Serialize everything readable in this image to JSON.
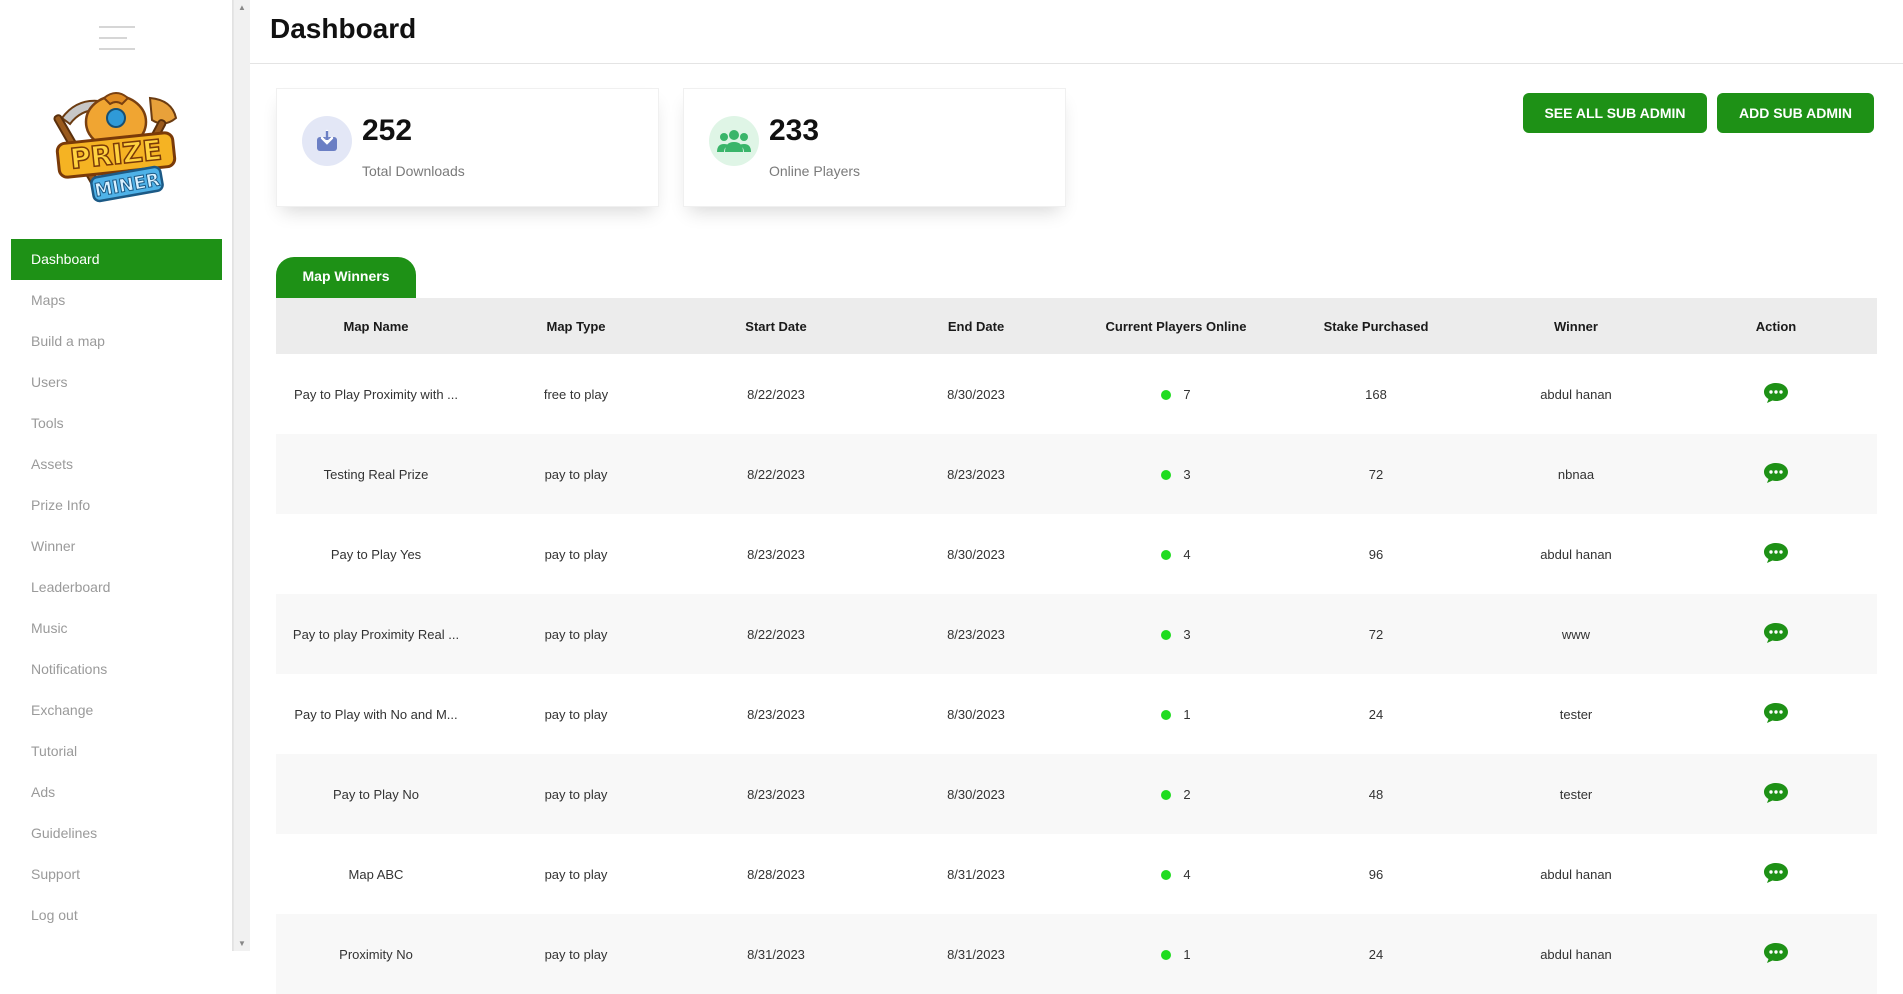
{
  "sidebar": {
    "logo_text": [
      "PRIZE",
      "MINER"
    ],
    "items": [
      {
        "label": "Dashboard",
        "active": true
      },
      {
        "label": "Maps"
      },
      {
        "label": "Build a map"
      },
      {
        "label": "Users"
      },
      {
        "label": "Tools"
      },
      {
        "label": "Assets"
      },
      {
        "label": "Prize Info"
      },
      {
        "label": "Winner"
      },
      {
        "label": "Leaderboard"
      },
      {
        "label": "Music"
      },
      {
        "label": "Notifications"
      },
      {
        "label": "Exchange"
      },
      {
        "label": "Tutorial"
      },
      {
        "label": "Ads"
      },
      {
        "label": "Guidelines"
      },
      {
        "label": "Support"
      },
      {
        "label": "Log out"
      }
    ]
  },
  "header": {
    "title": "Dashboard"
  },
  "stats": [
    {
      "value": "252",
      "label": "Total Downloads",
      "icon": "download-icon",
      "icon_bg": "#e3e7f6",
      "icon_color": "#6b7fc4"
    },
    {
      "value": "233",
      "label": "Online Players",
      "icon": "users-icon",
      "icon_bg": "#dff5e6",
      "icon_color": "#3ab56a"
    }
  ],
  "buttons": {
    "see_all": "SEE ALL SUB ADMIN",
    "add": "ADD SUB ADMIN"
  },
  "tab": {
    "label": "Map Winners"
  },
  "table": {
    "columns": [
      "Map Name",
      "Map Type",
      "Start Date",
      "End Date",
      "Current Players Online",
      "Stake Purchased",
      "Winner",
      "Action"
    ],
    "rows": [
      {
        "map_name": "Pay to Play Proximity with ...",
        "map_type": "free to play",
        "start": "8/22/2023",
        "end": "8/30/2023",
        "players": "7",
        "stake": "168",
        "winner": "abdul hanan"
      },
      {
        "map_name": "Testing Real Prize",
        "map_type": "pay to play",
        "start": "8/22/2023",
        "end": "8/23/2023",
        "players": "3",
        "stake": "72",
        "winner": "nbnaa"
      },
      {
        "map_name": "Pay to Play Yes",
        "map_type": "pay to play",
        "start": "8/23/2023",
        "end": "8/30/2023",
        "players": "4",
        "stake": "96",
        "winner": "abdul hanan"
      },
      {
        "map_name": "Pay to play Proximity Real ...",
        "map_type": "pay to play",
        "start": "8/22/2023",
        "end": "8/23/2023",
        "players": "3",
        "stake": "72",
        "winner": "www"
      },
      {
        "map_name": "Pay to Play with No and M...",
        "map_type": "pay to play",
        "start": "8/23/2023",
        "end": "8/30/2023",
        "players": "1",
        "stake": "24",
        "winner": "tester"
      },
      {
        "map_name": "Pay to Play No",
        "map_type": "pay to play",
        "start": "8/23/2023",
        "end": "8/30/2023",
        "players": "2",
        "stake": "48",
        "winner": "tester"
      },
      {
        "map_name": "Map ABC",
        "map_type": "pay to play",
        "start": "8/28/2023",
        "end": "8/31/2023",
        "players": "4",
        "stake": "96",
        "winner": "abdul hanan"
      },
      {
        "map_name": "Proximity No",
        "map_type": "pay to play",
        "start": "8/31/2023",
        "end": "8/31/2023",
        "players": "1",
        "stake": "24",
        "winner": "abdul hanan"
      }
    ]
  },
  "colors": {
    "accent": "#1e9116",
    "online_dot": "#1fdc1f"
  }
}
